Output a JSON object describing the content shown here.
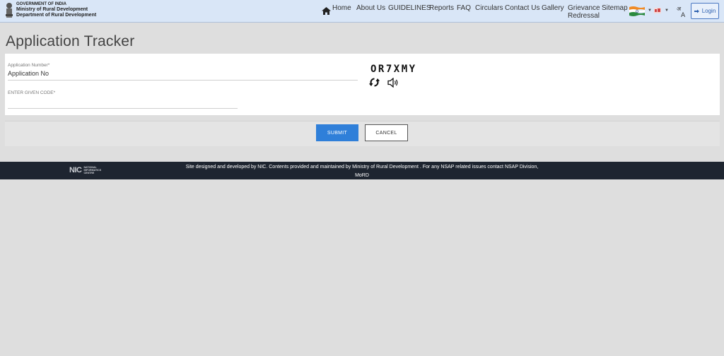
{
  "header": {
    "logo": {
      "line1": "GOVERNMENT OF INDIA",
      "line2": "Ministry of Rural Development",
      "line3": "Department of Rural Development"
    },
    "nav": {
      "home": "Home",
      "about": "About Us",
      "guidelines": "GUIDELINES",
      "reports": "Reports",
      "faq": "FAQ",
      "circulars": "Circulars",
      "contact": "Contact Us",
      "gallery": "Gallery",
      "grievance_line1": "Grievance",
      "grievance_line2": "Redressal",
      "sitemap": "Sitemap"
    },
    "login": "Login"
  },
  "page": {
    "title": "Application Tracker"
  },
  "form": {
    "app_no_label": "Application Number*",
    "app_no_value": "Application No",
    "code_label": "ENTER GIVEN CODE*",
    "code_value": "",
    "captcha": "OR7XMY",
    "submit": "SUBMIT",
    "cancel": "CANCEL"
  },
  "footer": {
    "nic_mark": "NIC",
    "nic_line1": "NATIONAL",
    "nic_line2": "INFORMATICS",
    "nic_line3": "CENTRE",
    "text_line1": "Site designed and developed by NIC. Contents provided and maintained by Ministry of Rural Development . For any NSAP related issues contact NSAP Division,",
    "text_line2": "MoRD"
  },
  "colors": {
    "header_bg": "#d9e6f7",
    "submit_bg": "#2f7fd9",
    "footer_bg": "#1e2530"
  },
  "icons": [
    "home-icon",
    "india-flag-icon",
    "language-icon",
    "login-icon",
    "refresh-icon",
    "speaker-icon"
  ]
}
